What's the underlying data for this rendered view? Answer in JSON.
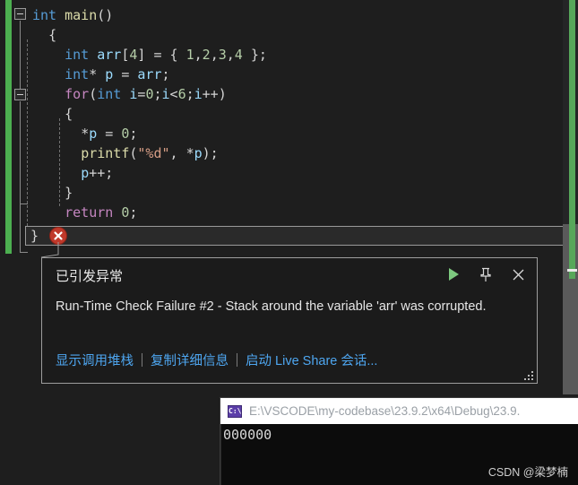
{
  "editor": {
    "language": "c",
    "theme_bg": "#1e1e1e",
    "change_bar_color": "#4caf50",
    "code_lines": [
      {
        "indent": 0,
        "tokens": [
          {
            "t": "int",
            "c": "kw"
          },
          {
            "t": " ",
            "c": "pun"
          },
          {
            "t": "main",
            "c": "fn"
          },
          {
            "t": "()",
            "c": "pun"
          }
        ]
      },
      {
        "indent": 1,
        "tokens": [
          {
            "t": "{",
            "c": "brc"
          }
        ]
      },
      {
        "indent": 2,
        "tokens": [
          {
            "t": "int",
            "c": "kw"
          },
          {
            "t": " ",
            "c": "pun"
          },
          {
            "t": "arr",
            "c": "var"
          },
          {
            "t": "[",
            "c": "pun"
          },
          {
            "t": "4",
            "c": "num"
          },
          {
            "t": "] = { ",
            "c": "pun"
          },
          {
            "t": "1",
            "c": "num"
          },
          {
            "t": ",",
            "c": "pun"
          },
          {
            "t": "2",
            "c": "num"
          },
          {
            "t": ",",
            "c": "pun"
          },
          {
            "t": "3",
            "c": "num"
          },
          {
            "t": ",",
            "c": "pun"
          },
          {
            "t": "4",
            "c": "num"
          },
          {
            "t": " };",
            "c": "pun"
          }
        ]
      },
      {
        "indent": 2,
        "tokens": [
          {
            "t": "int",
            "c": "kw"
          },
          {
            "t": "* ",
            "c": "pun"
          },
          {
            "t": "p",
            "c": "var"
          },
          {
            "t": " = ",
            "c": "pun"
          },
          {
            "t": "arr",
            "c": "var"
          },
          {
            "t": ";",
            "c": "pun"
          }
        ]
      },
      {
        "indent": 2,
        "tokens": [
          {
            "t": "for",
            "c": "ctl"
          },
          {
            "t": "(",
            "c": "pun"
          },
          {
            "t": "int",
            "c": "kw"
          },
          {
            "t": " ",
            "c": "pun"
          },
          {
            "t": "i",
            "c": "var"
          },
          {
            "t": "=",
            "c": "pun"
          },
          {
            "t": "0",
            "c": "num"
          },
          {
            "t": ";",
            "c": "pun"
          },
          {
            "t": "i",
            "c": "var"
          },
          {
            "t": "<",
            "c": "pun"
          },
          {
            "t": "6",
            "c": "num"
          },
          {
            "t": ";",
            "c": "pun"
          },
          {
            "t": "i",
            "c": "var"
          },
          {
            "t": "++)",
            "c": "pun"
          }
        ]
      },
      {
        "indent": 2,
        "tokens": [
          {
            "t": "{",
            "c": "brc"
          }
        ]
      },
      {
        "indent": 3,
        "tokens": [
          {
            "t": "*",
            "c": "pun"
          },
          {
            "t": "p",
            "c": "var"
          },
          {
            "t": " = ",
            "c": "pun"
          },
          {
            "t": "0",
            "c": "num"
          },
          {
            "t": ";",
            "c": "pun"
          }
        ]
      },
      {
        "indent": 3,
        "tokens": [
          {
            "t": "printf",
            "c": "fn"
          },
          {
            "t": "(",
            "c": "pun"
          },
          {
            "t": "\"%d\"",
            "c": "str"
          },
          {
            "t": ", ",
            "c": "pun"
          },
          {
            "t": "*",
            "c": "pun"
          },
          {
            "t": "p",
            "c": "var"
          },
          {
            "t": ");",
            "c": "pun"
          }
        ]
      },
      {
        "indent": 3,
        "tokens": [
          {
            "t": "p",
            "c": "var"
          },
          {
            "t": "++;",
            "c": "pun"
          }
        ]
      },
      {
        "indent": 2,
        "tokens": [
          {
            "t": "}",
            "c": "brc"
          }
        ]
      },
      {
        "indent": 2,
        "tokens": [
          {
            "t": "return",
            "c": "ctl"
          },
          {
            "t": " ",
            "c": "pun"
          },
          {
            "t": "0",
            "c": "num"
          },
          {
            "t": ";",
            "c": "pun"
          }
        ]
      }
    ],
    "current_line_text": "}",
    "breakpoint_marker": "error-x",
    "fold_markers": [
      {
        "line": 0
      },
      {
        "line": 4
      }
    ]
  },
  "exception_popup": {
    "title": "已引发异常",
    "message": "Run-Time Check Failure #2 - Stack around the variable 'arr' was corrupted.",
    "links": [
      "显示调用堆栈",
      "复制详细信息",
      "启动 Live Share 会话..."
    ],
    "buttons": {
      "continue": "▶",
      "pin": "pin",
      "close": "✕"
    },
    "accent_play_color": "#7dc97f"
  },
  "console_window": {
    "icon_label": "C:\\",
    "title_path": "E:\\VSCODE\\my-codebase\\23.9.2\\x64\\Debug\\23.9.",
    "output": "000000",
    "watermark": "CSDN @梁梦楠"
  }
}
